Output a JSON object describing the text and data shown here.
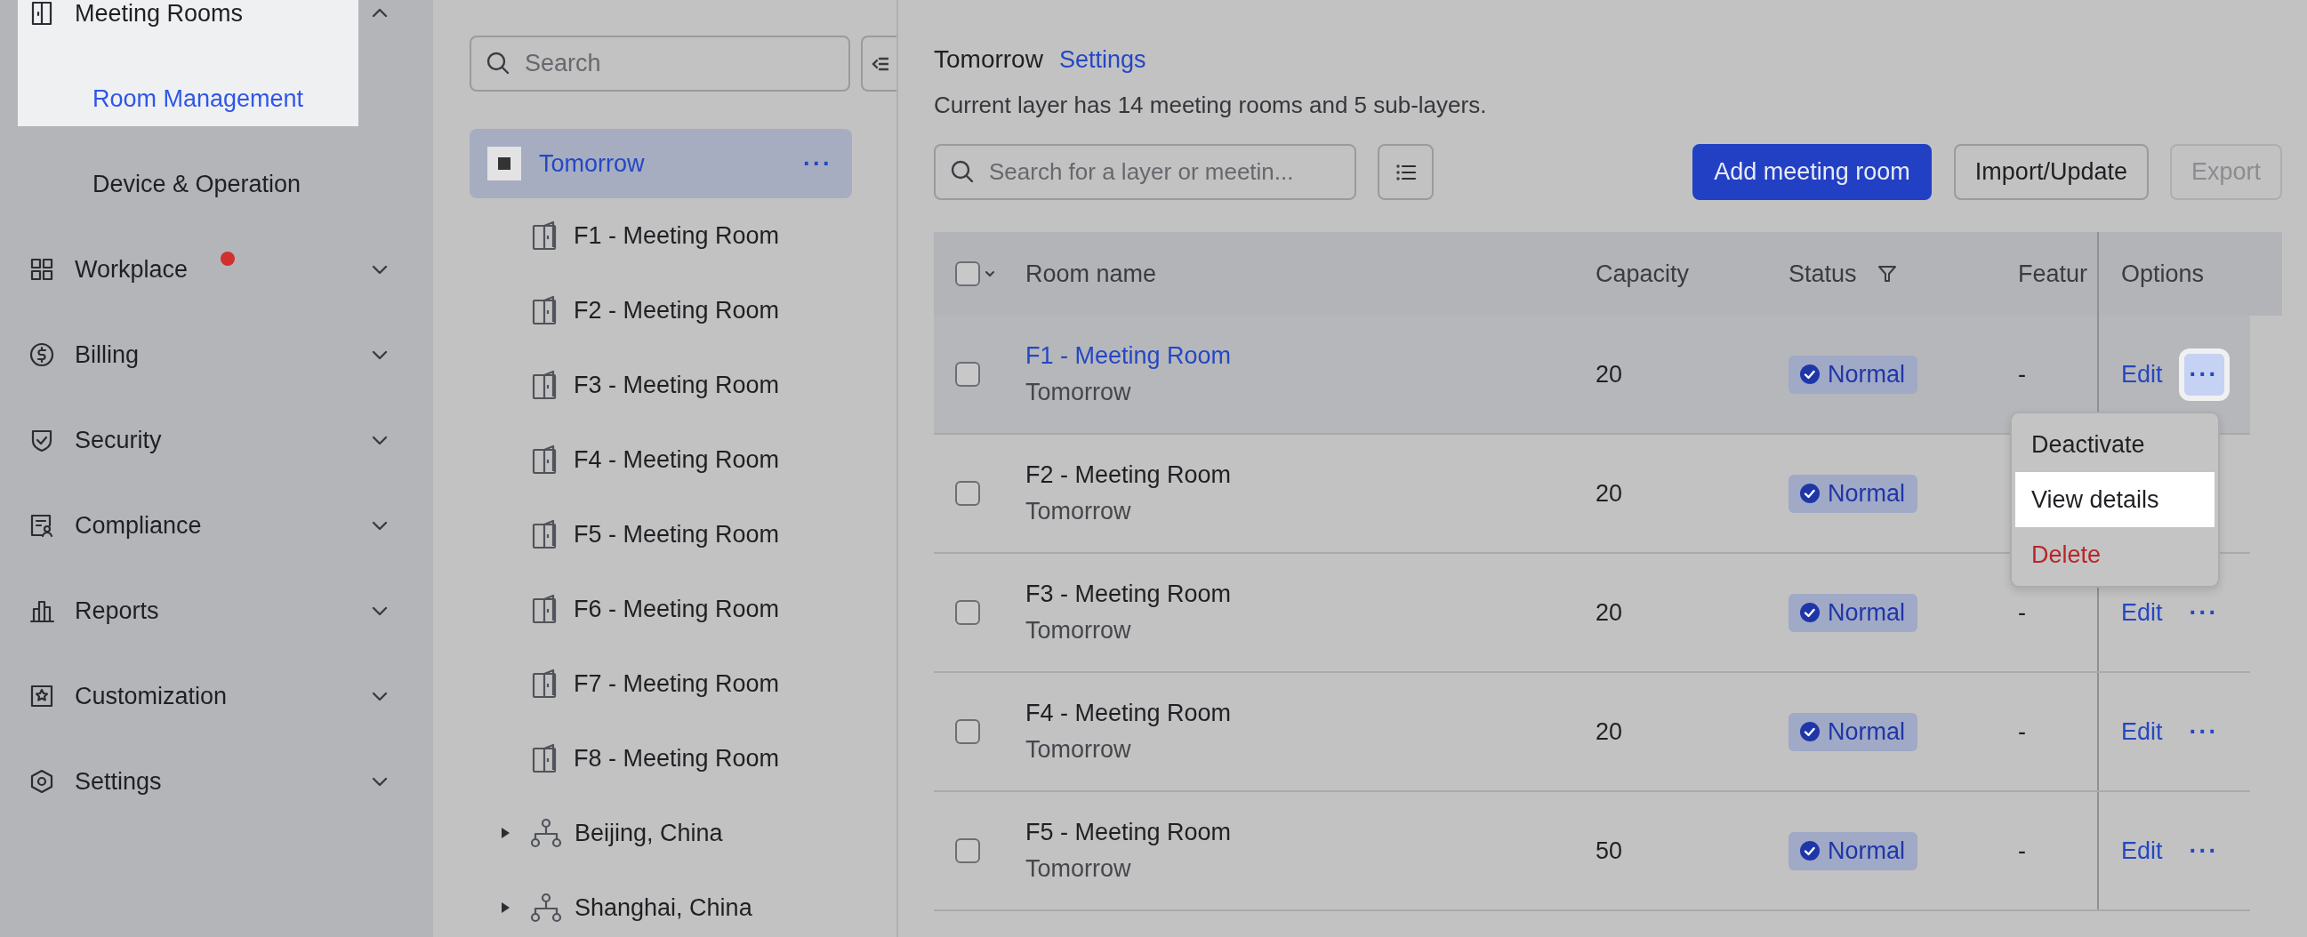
{
  "sidebar": {
    "groups": [
      {
        "label": "Meeting Rooms",
        "expanded": true,
        "children": [
          {
            "label": "Room Management",
            "selected": true
          },
          {
            "label": "Device & Operation",
            "selected": false
          }
        ]
      },
      {
        "label": "Workplace",
        "expanded": false,
        "badge": true
      },
      {
        "label": "Billing",
        "expanded": false
      },
      {
        "label": "Security",
        "expanded": false
      },
      {
        "label": "Compliance",
        "expanded": false
      },
      {
        "label": "Reports",
        "expanded": false
      },
      {
        "label": "Customization",
        "expanded": false
      },
      {
        "label": "Settings",
        "expanded": false
      }
    ]
  },
  "tree": {
    "search": {
      "placeholder": "Search"
    },
    "root": {
      "label": "Tomorrow",
      "selected": true,
      "more": "···"
    },
    "items": [
      {
        "kind": "room",
        "label": "F1 - Meeting Room"
      },
      {
        "kind": "room",
        "label": "F2 - Meeting Room"
      },
      {
        "kind": "room",
        "label": "F3 - Meeting Room"
      },
      {
        "kind": "room",
        "label": "F4 - Meeting Room"
      },
      {
        "kind": "room",
        "label": "F5 - Meeting Room"
      },
      {
        "kind": "room",
        "label": "F6 - Meeting Room"
      },
      {
        "kind": "room",
        "label": "F7 - Meeting Room"
      },
      {
        "kind": "room",
        "label": "F8 - Meeting Room"
      },
      {
        "kind": "layer",
        "label": "Beijing, China",
        "expanded": false
      },
      {
        "kind": "layer",
        "label": "Shanghai, China",
        "expanded": false
      }
    ]
  },
  "main": {
    "title": "Tomorrow",
    "settings_link": "Settings",
    "summary": "Current layer has 14 meeting rooms and 5 sub-layers.",
    "search": {
      "placeholder": "Search for a layer or meetin..."
    },
    "buttons": [
      {
        "label": "Add meeting room",
        "kind": "primary",
        "disabled": false
      },
      {
        "label": "Import/Update",
        "kind": "default",
        "disabled": false
      },
      {
        "label": "Export",
        "kind": "default",
        "disabled": true
      }
    ],
    "table": {
      "select_all_checked": false,
      "columns": [
        "Room name",
        "Capacity",
        "Status",
        "Featur",
        "Options"
      ],
      "rows": [
        {
          "name": "F1 - Meeting Room",
          "layer": "Tomorrow",
          "capacity": "20",
          "status": "Normal",
          "feature": "-",
          "edit": "Edit",
          "more": "···",
          "selected": true,
          "checked": false,
          "menu_open": true
        },
        {
          "name": "F2 - Meeting Room",
          "layer": "Tomorrow",
          "capacity": "20",
          "status": "Normal",
          "selected": false,
          "checked": false,
          "menu_open": false
        },
        {
          "name": "F3 - Meeting Room",
          "layer": "Tomorrow",
          "capacity": "20",
          "status": "Normal",
          "feature": "-",
          "edit": "Edit",
          "more": "···",
          "selected": false,
          "checked": false,
          "menu_open": false
        },
        {
          "name": "F4 - Meeting Room",
          "layer": "Tomorrow",
          "capacity": "20",
          "status": "Normal",
          "feature": "-",
          "edit": "Edit",
          "more": "···",
          "selected": false,
          "checked": false,
          "menu_open": false
        },
        {
          "name": "F5 - Meeting Room",
          "layer": "Tomorrow",
          "capacity": "50",
          "status": "Normal",
          "feature": "-",
          "edit": "Edit",
          "more": "···",
          "selected": false,
          "checked": false,
          "menu_open": false
        }
      ],
      "menu": {
        "items": [
          {
            "label": "Deactivate",
            "kind": "normal",
            "selected": false
          },
          {
            "label": "View details",
            "kind": "normal",
            "selected": true
          },
          {
            "label": "Delete",
            "kind": "danger",
            "selected": false
          }
        ]
      }
    }
  }
}
